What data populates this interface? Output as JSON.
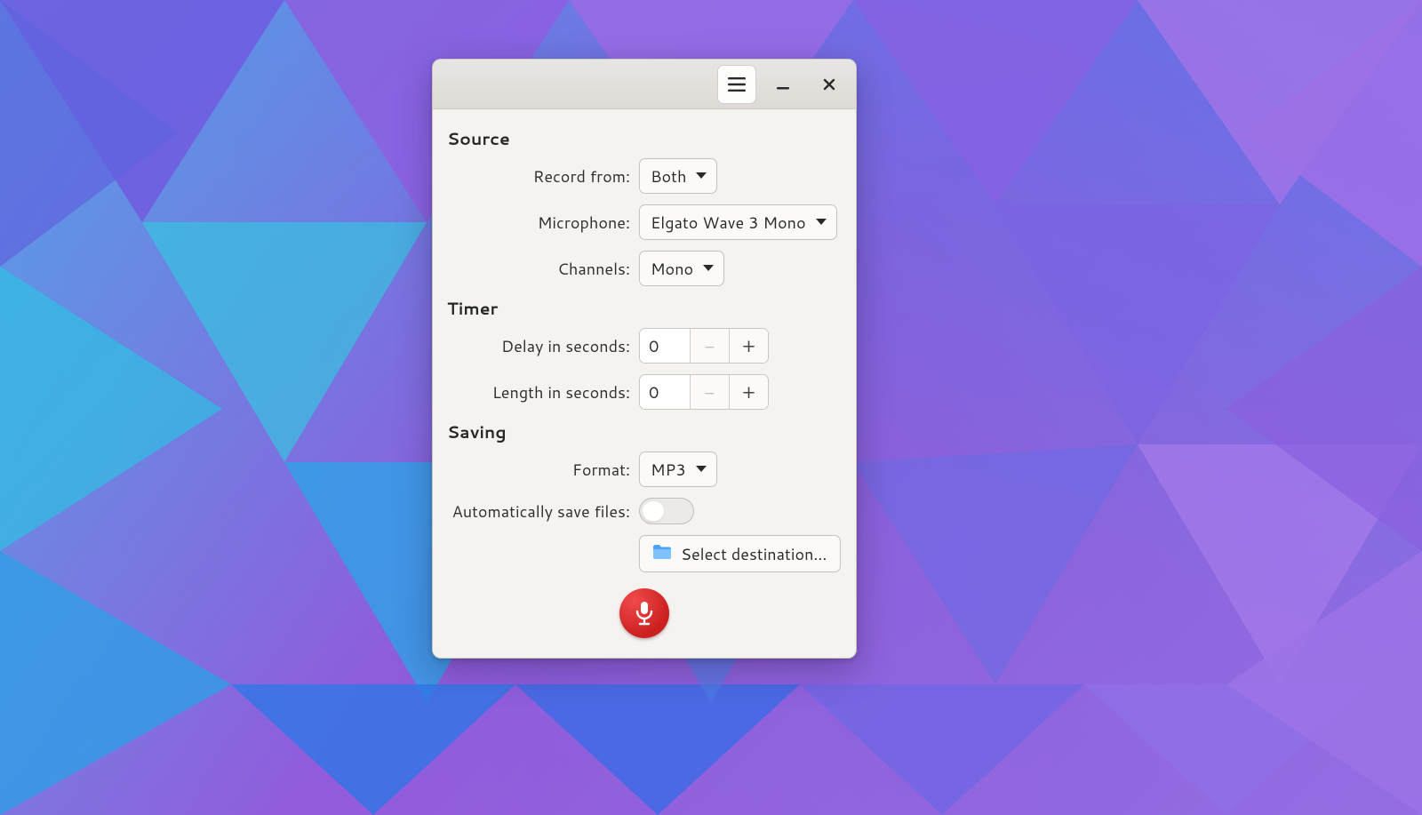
{
  "sections": {
    "source": {
      "title": "Source",
      "record_from_label": "Record from:",
      "record_from_value": "Both",
      "microphone_label": "Microphone:",
      "microphone_value": "Elgato Wave 3 Mono",
      "channels_label": "Channels:",
      "channels_value": "Mono"
    },
    "timer": {
      "title": "Timer",
      "delay_label": "Delay in seconds:",
      "delay_value": "0",
      "length_label": "Length in seconds:",
      "length_value": "0"
    },
    "saving": {
      "title": "Saving",
      "format_label": "Format:",
      "format_value": "MP3",
      "autosave_label": "Automatically save files:",
      "autosave_on": false,
      "destination_label": "Select destination…"
    }
  },
  "spin_minus": "−",
  "spin_plus": "+"
}
